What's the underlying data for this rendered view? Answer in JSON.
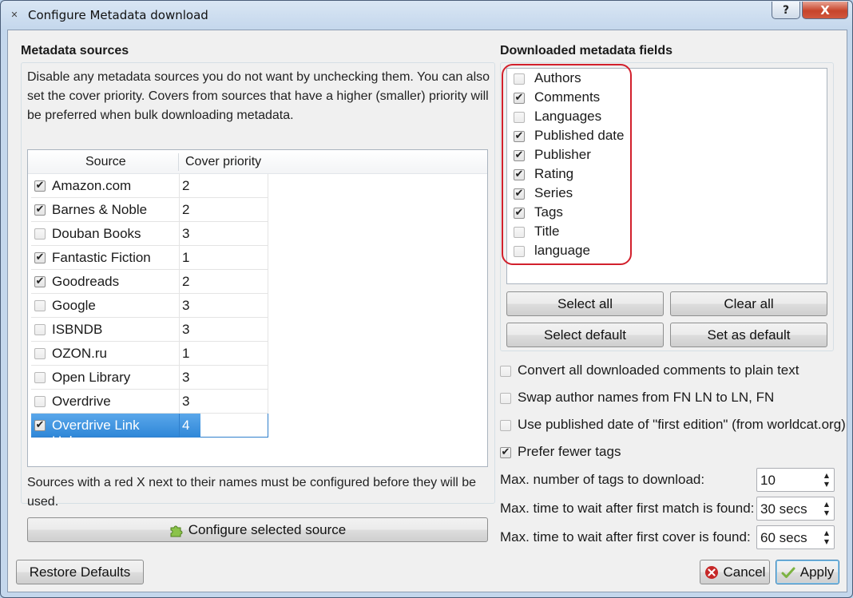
{
  "window": {
    "title": "Configure Metadata download",
    "help_label": "?",
    "close_label": "X"
  },
  "sources": {
    "title": "Metadata sources",
    "description": "Disable any metadata sources you do not want by unchecking them. You can also set the cover priority. Covers from sources that have a higher (smaller) priority will be preferred when bulk downloading metadata.",
    "columns": [
      "Source",
      "Cover priority"
    ],
    "rows": [
      {
        "name": "Amazon.com",
        "checked": true,
        "priority": "2"
      },
      {
        "name": "Barnes & Noble",
        "checked": true,
        "priority": "2"
      },
      {
        "name": "Douban Books",
        "checked": false,
        "priority": "3"
      },
      {
        "name": "Fantastic Fiction",
        "checked": true,
        "priority": "1"
      },
      {
        "name": "Goodreads",
        "checked": true,
        "priority": "2"
      },
      {
        "name": "Google",
        "checked": false,
        "priority": "3"
      },
      {
        "name": "ISBNDB",
        "checked": false,
        "priority": "3"
      },
      {
        "name": "OZON.ru",
        "checked": false,
        "priority": "1"
      },
      {
        "name": "Open Library",
        "checked": false,
        "priority": "3"
      },
      {
        "name": "Overdrive",
        "checked": false,
        "priority": "3"
      },
      {
        "name": "Overdrive Link Helper",
        "checked": true,
        "priority": "4",
        "selected": true
      }
    ],
    "footnote": "Sources with a red X next to their names must be configured before they will be used.",
    "configure_button": "Configure selected source"
  },
  "fields": {
    "title": "Downloaded metadata fields",
    "items": [
      {
        "label": "Authors",
        "checked": false
      },
      {
        "label": "Comments",
        "checked": true
      },
      {
        "label": "Languages",
        "checked": false
      },
      {
        "label": "Published date",
        "checked": true
      },
      {
        "label": "Publisher",
        "checked": true
      },
      {
        "label": "Rating",
        "checked": true
      },
      {
        "label": "Series",
        "checked": true
      },
      {
        "label": "Tags",
        "checked": true
      },
      {
        "label": "Title",
        "checked": false
      },
      {
        "label": "language",
        "checked": false
      }
    ],
    "highlight_color": "#d2202c",
    "select_all": "Select all",
    "clear_all": "Clear all",
    "select_default": "Select default",
    "set_as_default": "Set as default"
  },
  "options": [
    {
      "label": "Convert all downloaded comments to plain text",
      "checked": false
    },
    {
      "label": "Swap author names from FN LN to LN, FN",
      "checked": false
    },
    {
      "label": "Use published date of \"first edition\" (from worldcat.org)",
      "checked": false
    },
    {
      "label": "Prefer fewer tags",
      "checked": true
    }
  ],
  "spinners": [
    {
      "label": "Max. number of tags to download:",
      "value": "10"
    },
    {
      "label": "Max. time to wait after first match is found:",
      "value": "30 secs"
    },
    {
      "label": "Max. time to wait after first cover is found:",
      "value": "60 secs"
    }
  ],
  "footer": {
    "restore_defaults": "Restore Defaults",
    "cancel": "Cancel",
    "apply": "Apply"
  },
  "colors": {
    "selection": "#3a8fde",
    "cancel_icon": "#c62828",
    "apply_icon": "#7cb342",
    "plugin_icon": "#8bc34a"
  }
}
